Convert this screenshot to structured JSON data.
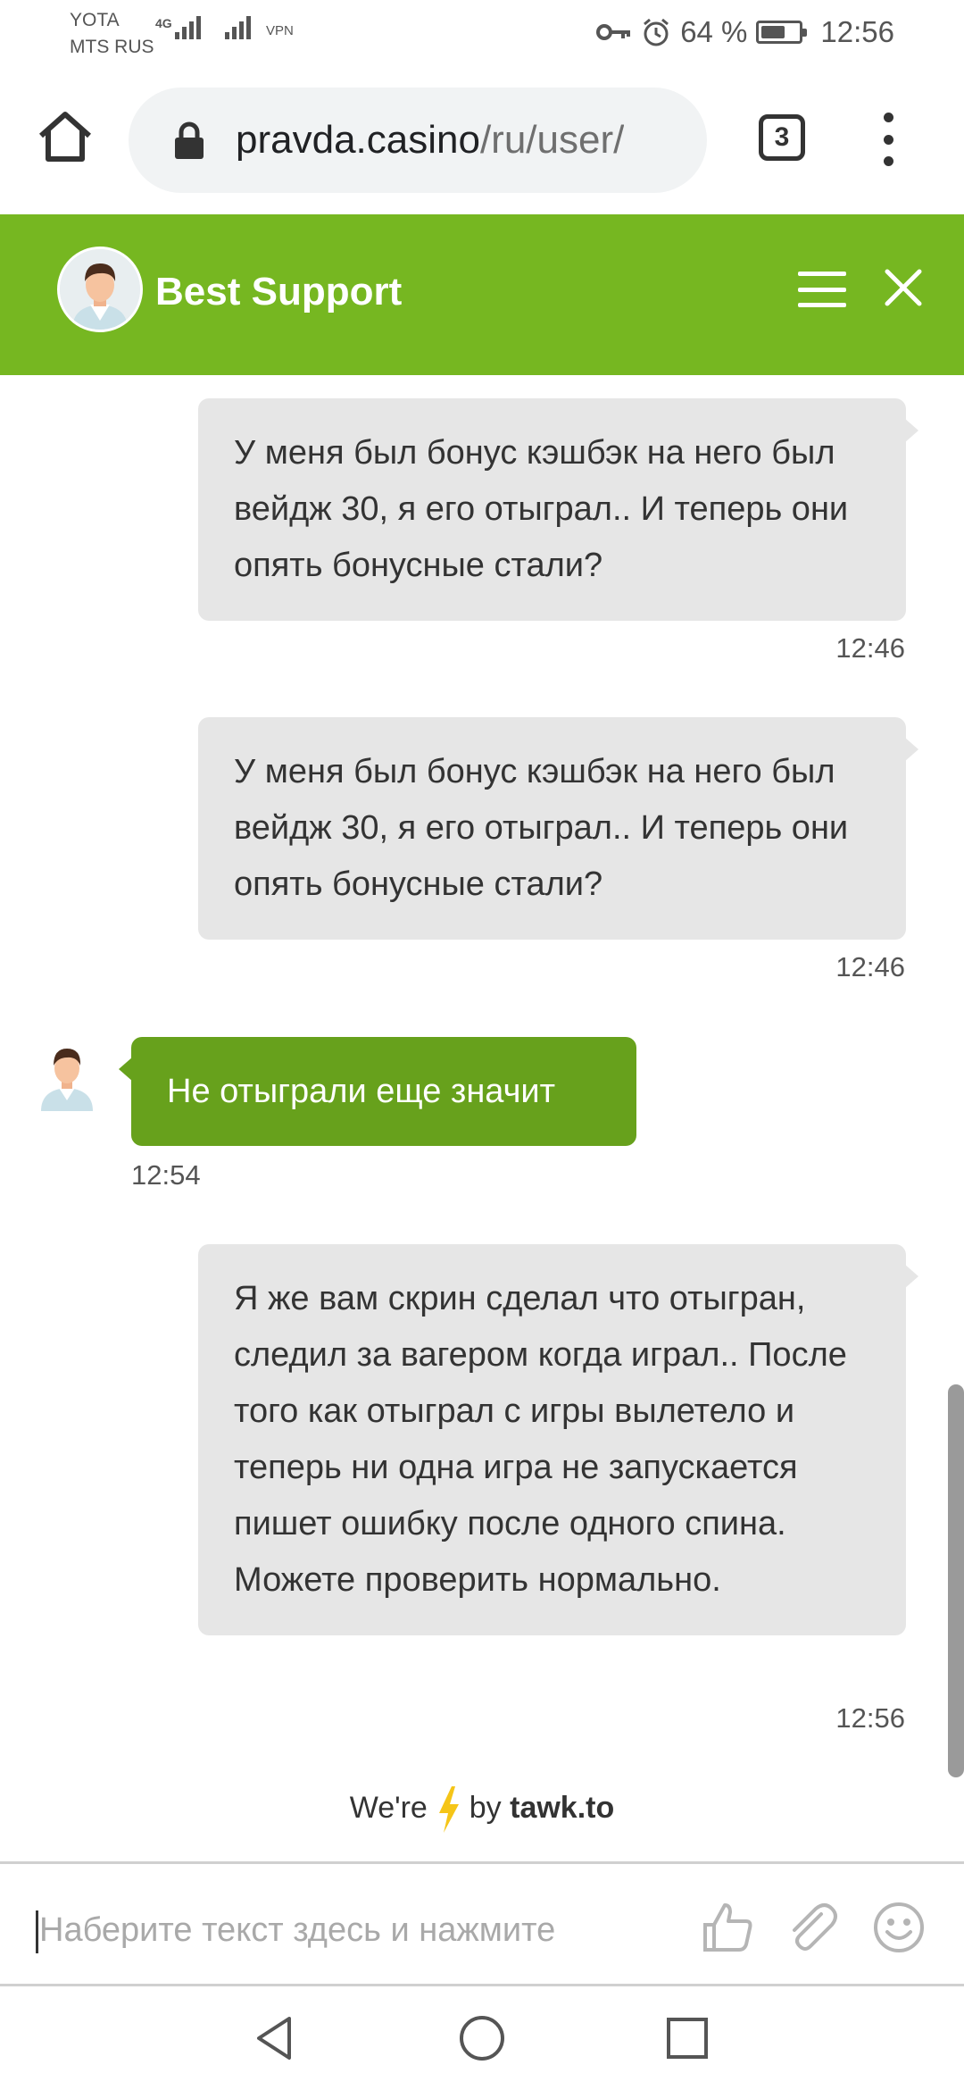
{
  "status_bar": {
    "carrier_1": "YOTA",
    "carrier_2": "MTS RUS",
    "network_badge": "4G",
    "vpn": "VPN",
    "battery_text": "64 %",
    "battery_level": 0.64,
    "time": "12:56",
    "icons": [
      "key-icon",
      "alarm-icon",
      "battery-icon"
    ]
  },
  "browser": {
    "url_domain": "pravda.casino",
    "url_path": "/ru/user/",
    "tab_count": "3",
    "icons": [
      "home-icon",
      "lock-icon",
      "tabs-icon",
      "more-icon"
    ]
  },
  "chat": {
    "header": {
      "agent_name": "Best Support",
      "accent_color": "#76b721"
    },
    "messages": [
      {
        "direction": "out",
        "text": "У меня был бонус  кэшбэк на него был вейдж 30, я его отыграл.. И теперь они опять бонусные стали?",
        "time": "12:46"
      },
      {
        "direction": "out",
        "text": "У меня был бонус  кэшбэк на него был вейдж 30, я его отыграл.. И теперь они опять бонусные стали?",
        "time": "12:46"
      },
      {
        "direction": "in",
        "text": "Не отыграли еще значит",
        "time": "12:54"
      },
      {
        "direction": "out",
        "text": "Я же вам скрин сделал что отыгран, следил за вагером когда играл.. После того как отыграл с игры вылетело и теперь ни одна игра не запускается пишет ошибку после одного спина. Можете проверить нормально.",
        "time": "12:56"
      }
    ],
    "powered_prefix": "We're",
    "powered_by": "by",
    "powered_brand": "tawk.to",
    "input_placeholder": "Наберите текст здесь и нажмите"
  },
  "nav": {
    "icons": [
      "back-icon",
      "home-circle-icon",
      "recents-icon"
    ]
  }
}
